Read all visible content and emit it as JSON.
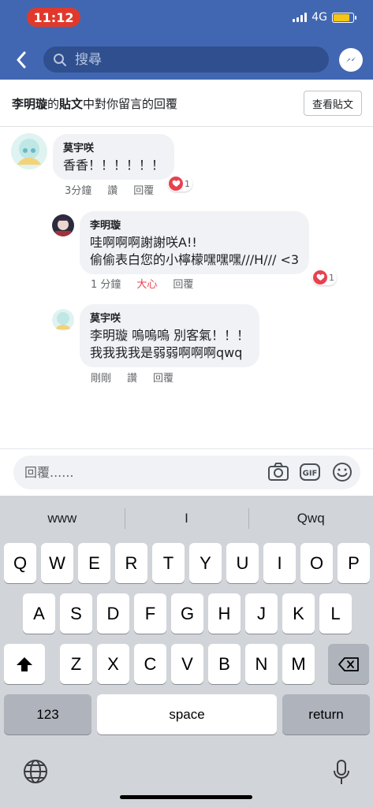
{
  "status_bar": {
    "time": "11:12",
    "network": "4G",
    "battery_level": 0.85,
    "battery_color": "#f5c518"
  },
  "nav": {
    "search_placeholder": "搜尋",
    "back_icon": "chevron-left-icon",
    "messenger_icon": "messenger-icon"
  },
  "header": {
    "author": "李明璇",
    "post_word": "的",
    "post_link": "貼文",
    "suffix": "中對你留言的回覆",
    "view_post_label": "查看貼文"
  },
  "comments": [
    {
      "name": "莫宇咲",
      "lines": [
        "香香！！！！！！"
      ],
      "time": "3分鐘",
      "like_label": "讚",
      "reply_label": "回覆",
      "reactions": "1"
    },
    {
      "name": "李明璇",
      "lines": [
        "哇啊啊啊謝謝咲A!!",
        "偷偷表白您的小檸檬嘿嘿嘿///H/// <3"
      ],
      "time": "1 分鐘",
      "like_label": "大心",
      "reply_label": "回覆",
      "reactions": "1"
    },
    {
      "name": "莫宇咲",
      "lines": [
        "李明璇  嗚嗚嗚 別客氣！！！",
        "我我我我是弱弱啊啊啊qwq"
      ],
      "time": "剛剛",
      "like_label": "讚",
      "reply_label": "回覆"
    }
  ],
  "reply_bar": {
    "placeholder": "回覆......",
    "icons": [
      "camera-icon",
      "gif-icon",
      "emoji-icon"
    ]
  },
  "keyboard": {
    "suggestions": [
      "www",
      "I",
      "Qwq"
    ],
    "row1": [
      "Q",
      "W",
      "E",
      "R",
      "T",
      "Y",
      "U",
      "I",
      "O",
      "P"
    ],
    "row2": [
      "A",
      "S",
      "D",
      "F",
      "G",
      "H",
      "J",
      "K",
      "L"
    ],
    "row3": [
      "Z",
      "X",
      "C",
      "V",
      "B",
      "N",
      "M"
    ],
    "numbers_label": "123",
    "space_label": "space",
    "return_label": "return"
  },
  "colors": {
    "brand": "#4267b2",
    "love": "#e8414f",
    "status_pill": "#e0392c"
  }
}
